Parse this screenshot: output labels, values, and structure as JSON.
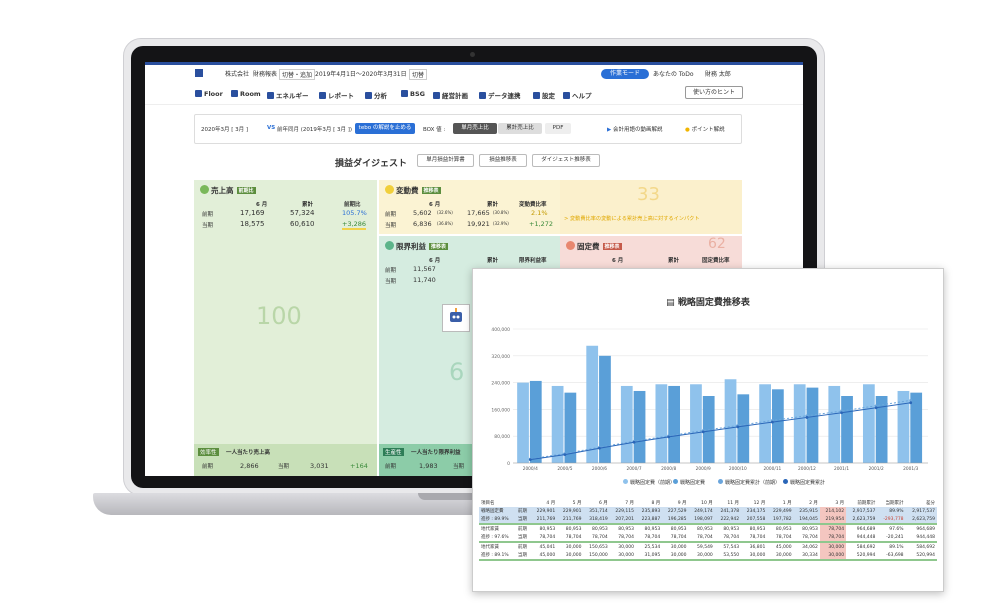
{
  "app": {
    "company": "株式会社",
    "topbar_text": "財務報表",
    "topbar_switch": "切替・追加",
    "period": "2019年4月1日〜2020年3月31日",
    "period_switch": "切替",
    "mode": "作業モード",
    "todo": "あなたの ToDo",
    "user": "財務 太郎"
  },
  "nav": {
    "items": [
      "Floor",
      "Room",
      "エネルギー",
      "レポート",
      "分析",
      "BSG",
      "経営計画",
      "データ連携",
      "設定",
      "ヘルプ"
    ],
    "hint": "使い方のヒント"
  },
  "filter": {
    "current": "2020年3月 [ 3月 ]",
    "vs": "VS",
    "previous": "前年同月 (2019年3月 [ 3月 ])",
    "toggle": "tebo の解説を止める",
    "box_label": "BOX 値 :",
    "single_month": "単月売上比",
    "cumulative": "累計売上比",
    "pdf": "PDF",
    "video": "会計用語の動画解説",
    "point": "ポイント解説"
  },
  "digest": {
    "title": "損益ダイジェスト",
    "tabs": [
      "単月損益計算書",
      "損益推移表",
      "ダイジェスト推移表"
    ]
  },
  "sales": {
    "label": "売上高",
    "badge": "前期比",
    "col_month": "6 月",
    "col_cum": "累計",
    "col_ratio": "前期比",
    "prev_label": "前期",
    "curr_label": "当期",
    "prev_month": "17,169",
    "prev_cum": "57,324",
    "prev_ratio": "105.7%",
    "curr_month": "18,575",
    "curr_cum": "60,610",
    "curr_ratio": "+3,286",
    "big": "100",
    "footer_badge": "効率性",
    "footer_title": "一人当たり売上高",
    "footer_prev_label": "前期",
    "footer_prev": "2,866",
    "footer_curr_label": "当期",
    "footer_curr": "3,031",
    "footer_diff": "+164"
  },
  "variable": {
    "label": "変動費",
    "badge": "推移表",
    "col_month": "6 月",
    "col_cum": "累計",
    "col_ratio": "変動費比率",
    "prev_label": "前期",
    "curr_label": "当期",
    "prev_month": "5,602",
    "prev_pct": "(32.6%)",
    "prev_cum": "17,665",
    "prev_cum_pct": "(30.8%)",
    "prev_ratio": "2.1%",
    "curr_month": "6,836",
    "curr_pct": "(36.8%)",
    "curr_cum": "19,921",
    "curr_cum_pct": "(32.9%)",
    "curr_ratio": "+1,272",
    "big": "33",
    "impact": "> 変動費比率の変動による累計売上高に対するインパクト"
  },
  "margin": {
    "label": "限界利益",
    "badge": "推移表",
    "col_month": "6 月",
    "col_cum": "累計",
    "col_ratio": "限界利益率",
    "prev_label": "前期",
    "curr_label": "当期",
    "prev_month": "11,567",
    "curr_month": "11,740",
    "big": "6",
    "footer_badge": "生産性",
    "footer_title": "一人当たり限界利益",
    "footer_prev_label": "前期",
    "footer_prev": "1,983",
    "footer_curr_label": "当期"
  },
  "fixed": {
    "label": "固定費",
    "badge": "推移表",
    "col_month": "6 月",
    "col_cum": "累計",
    "col_ratio": "固定費比率",
    "big": "62"
  },
  "overlay": {
    "title": "戦略固定費推移表",
    "legend": [
      "戦略固定費（前期）",
      "戦略固定費",
      "戦略固定費累計（前期）",
      "戦略固定費累計"
    ]
  },
  "colors": {
    "brand": "#2a4f9e",
    "bar_prev": "#8fc2ec",
    "bar_curr": "#5a9fd8",
    "line": "#2a66b8"
  },
  "chart_data": {
    "type": "bar",
    "title": "戦略固定費推移表",
    "categories": [
      "2000/4",
      "2000/5",
      "2000/6",
      "2000/7",
      "2000/8",
      "2000/9",
      "2000/10",
      "2000/11",
      "2000/12",
      "2001/1",
      "2001/2",
      "2001/3"
    ],
    "y_ticks": [
      "0",
      "80,000",
      "160,000",
      "240,000",
      "320,000",
      "400,000"
    ],
    "ylim": [
      0,
      400000
    ],
    "series": [
      {
        "name": "戦略固定費（前期）",
        "type": "bar",
        "values": [
          240000,
          230000,
          350000,
          230000,
          235000,
          235000,
          250000,
          235000,
          235000,
          230000,
          235000,
          215000
        ]
      },
      {
        "name": "戦略固定費",
        "type": "bar",
        "values": [
          245000,
          210000,
          320000,
          215000,
          230000,
          200000,
          205000,
          220000,
          225000,
          200000,
          200000,
          210000
        ]
      },
      {
        "name": "戦略固定費累計（前期）",
        "type": "line",
        "dashed": true,
        "values": [
          12000,
          28000,
          47000,
          65000,
          81000,
          97000,
          112000,
          127000,
          141000,
          155000,
          171000,
          187000
        ]
      },
      {
        "name": "戦略固定費累計",
        "type": "line",
        "values": [
          10000,
          25000,
          44000,
          62000,
          78000,
          93000,
          108000,
          122000,
          136000,
          150000,
          165000,
          180000
        ]
      }
    ]
  },
  "table": {
    "months": [
      "4 月",
      "5 月",
      "6 月",
      "7 月",
      "8 月",
      "9 月",
      "10 月",
      "11 月",
      "12 月",
      "1 月",
      "2 月",
      "3 月",
      "前期累計",
      "当期累計",
      "差分"
    ],
    "rows": [
      {
        "label": "戦略固定費",
        "sub": "前期",
        "values": [
          "229,901",
          "229,901",
          "351,714",
          "229,115",
          "235,893",
          "227,529",
          "249,174",
          "241,378",
          "234,175",
          "229,499",
          "235,915",
          "214,102",
          "2,917,537",
          "89.9%",
          "2,917,537"
        ]
      },
      {
        "label": "進捗 : 89.9%",
        "sub": "当期",
        "values": [
          "211,769",
          "211,769",
          "318,419",
          "207,201",
          "223,887",
          "196,285",
          "198,097",
          "222,942",
          "207,558",
          "197,782",
          "194,045",
          "219,954",
          "2,623,759",
          "-293,778",
          "2,623,759"
        ]
      },
      {
        "label": "地代家賃",
        "sub": "前期",
        "values": [
          "80,953",
          "80,953",
          "80,953",
          "80,953",
          "80,953",
          "80,953",
          "80,953",
          "80,953",
          "80,953",
          "80,953",
          "80,953",
          "78,704",
          "964,689",
          "97.6%",
          "964,689"
        ]
      },
      {
        "label": "進捗 : 97.6%",
        "sub": "当期",
        "values": [
          "78,704",
          "78,704",
          "78,704",
          "78,704",
          "78,704",
          "78,704",
          "78,704",
          "78,704",
          "78,704",
          "78,704",
          "78,704",
          "78,704",
          "944,448",
          "-20,241",
          "944,448"
        ]
      },
      {
        "label": "地代家賃",
        "sub": "前期",
        "values": [
          "45,041",
          "30,000",
          "150,653",
          "30,000",
          "25,534",
          "30,000",
          "59,549",
          "57,543",
          "36,801",
          "45,000",
          "34,062",
          "30,000",
          "584,692",
          "89.1%",
          "584,692"
        ]
      },
      {
        "label": "進捗 : 89.1%",
        "sub": "当期",
        "values": [
          "45,000",
          "30,000",
          "150,000",
          "30,000",
          "31,095",
          "30,000",
          "30,000",
          "53,550",
          "30,000",
          "30,000",
          "30,334",
          "30,000",
          "520,994",
          "-63,698",
          "520,994"
        ]
      }
    ]
  }
}
